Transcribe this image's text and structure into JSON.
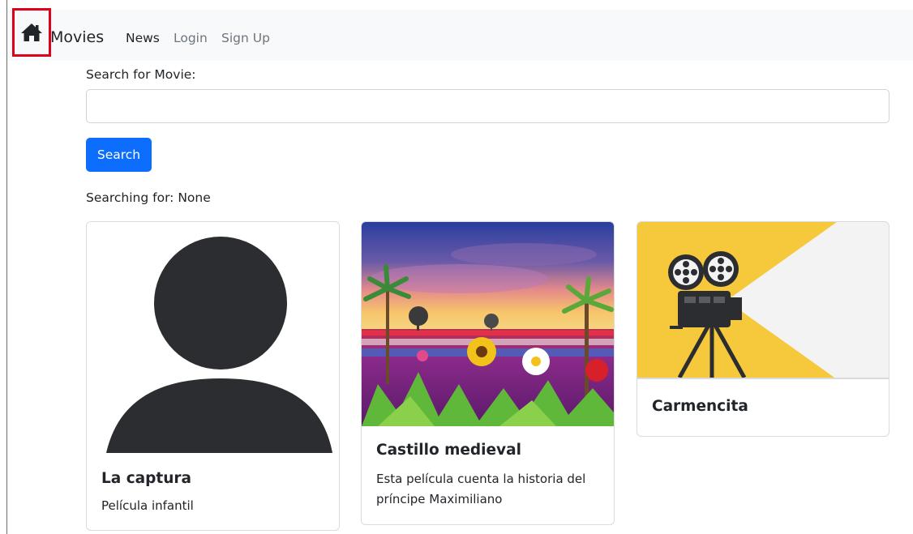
{
  "navbar": {
    "home_icon": "home-icon",
    "brand": "Movies",
    "links": [
      {
        "label": "News",
        "active": true
      },
      {
        "label": "Login",
        "active": false
      },
      {
        "label": "Sign Up",
        "active": false
      }
    ]
  },
  "search": {
    "label": "Search for Movie:",
    "value": "",
    "placeholder": "",
    "button_label": "Search",
    "status": "Searching for: None"
  },
  "movies": [
    {
      "title": "La captura",
      "description": "Película infantil",
      "image": "user-avatar-placeholder"
    },
    {
      "title": "Castillo medieval",
      "description": "Esta película cuenta la historia del príncipe Maximiliano",
      "image": "tulip-field-sunset-with-palm-trees"
    },
    {
      "title": "Carmencita",
      "description": "",
      "image": "film-projector-illustration"
    }
  ],
  "colors": {
    "primary": "#0d6efd",
    "navbar_bg": "#f8f9fa",
    "highlight_box": "#e0001a",
    "projector_yellow": "#f5c93b"
  }
}
